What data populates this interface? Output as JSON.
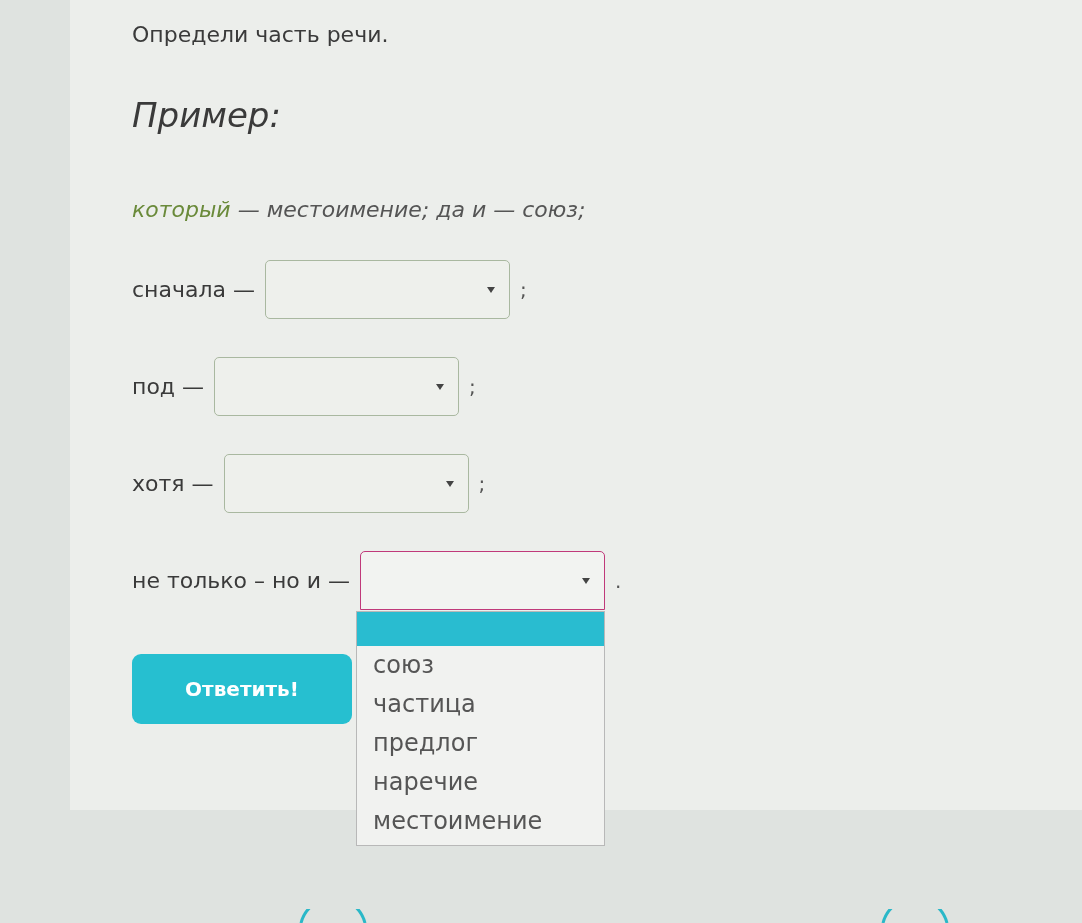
{
  "instruction": "Определи часть речи.",
  "example": {
    "heading": "Пример:",
    "segments": [
      {
        "text": "который",
        "highlight": true
      },
      {
        "text": " — местоимение; да и — союз;",
        "highlight": false
      }
    ]
  },
  "items": [
    {
      "word": "сначала —",
      "suffix": ";",
      "focused": false,
      "open": false
    },
    {
      "word": "под —",
      "suffix": ";",
      "focused": false,
      "open": false
    },
    {
      "word": "хотя —",
      "suffix": ";",
      "focused": false,
      "open": false
    },
    {
      "word": "не только – но и —",
      "suffix": ".",
      "focused": true,
      "open": true
    }
  ],
  "dropdown": {
    "blank_highlighted": true,
    "options": [
      {
        "label": "союз",
        "selected": false
      },
      {
        "label": "частица",
        "selected": false
      },
      {
        "label": "предлог",
        "selected": false
      },
      {
        "label": "наречие",
        "selected": false
      },
      {
        "label": "местоимение",
        "selected": false
      }
    ]
  },
  "submit": "Ответить!"
}
